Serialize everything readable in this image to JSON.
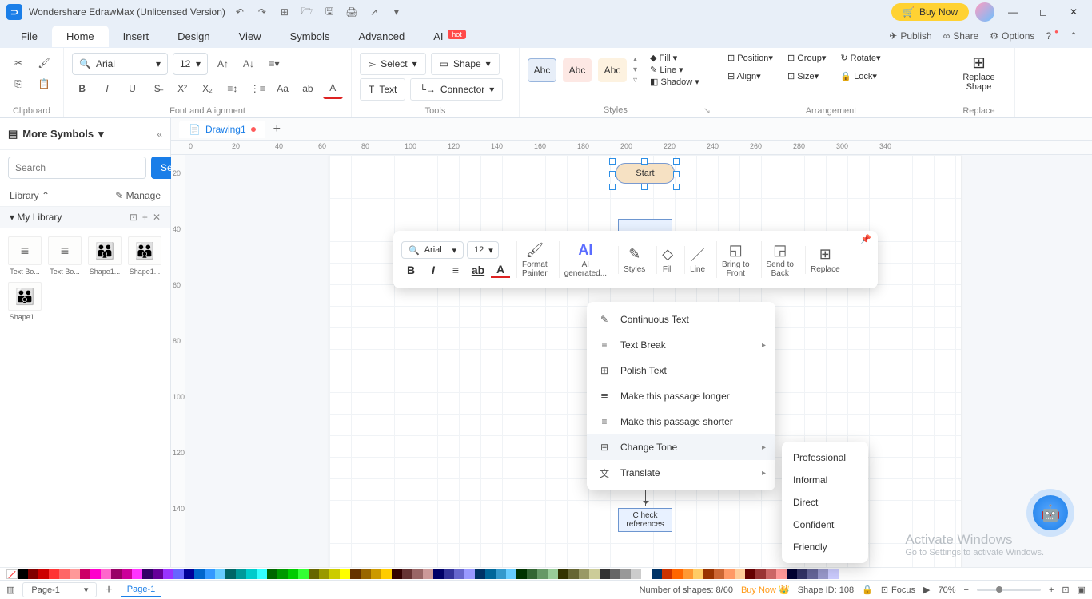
{
  "title": "Wondershare EdrawMax (Unlicensed Version)",
  "buy_now": "Buy Now",
  "menu": {
    "file": "File",
    "home": "Home",
    "insert": "Insert",
    "design": "Design",
    "view": "View",
    "symbols": "Symbols",
    "advanced": "Advanced",
    "ai": "AI",
    "ai_badge": "hot"
  },
  "menu_right": {
    "publish": "Publish",
    "share": "Share",
    "options": "Options"
  },
  "ribbon": {
    "clipboard": "Clipboard",
    "font_align": "Font and Alignment",
    "font_name": "Arial",
    "font_size": "12",
    "tools": "Tools",
    "select": "Select",
    "shape": "Shape",
    "text": "Text",
    "connector": "Connector",
    "styles": "Styles",
    "abc": "Abc",
    "fill": "Fill",
    "line": "Line",
    "shadow": "Shadow",
    "arrangement": "Arrangement",
    "position": "Position",
    "align": "Align",
    "group": "Group",
    "size": "Size",
    "rotate": "Rotate",
    "lock": "Lock",
    "replace": "Replace",
    "replace_shape": "Replace\nShape"
  },
  "left": {
    "more_symbols": "More Symbols",
    "search_placeholder": "Search",
    "search_btn": "Search",
    "library": "Library",
    "manage": "Manage",
    "my_library": "My Library",
    "shapes": [
      "Text Bo...",
      "Text Bo...",
      "Shape1...",
      "Shape1...",
      "Shape1..."
    ]
  },
  "tab": {
    "name": "Drawing1"
  },
  "ruler_h": [
    "0",
    "20",
    "40",
    "60",
    "80",
    "100",
    "120",
    "140",
    "160",
    "180",
    "200",
    "220",
    "240",
    "260",
    "280",
    "300",
    "340"
  ],
  "ruler_v": [
    "20",
    "40",
    "60",
    "80",
    "100",
    "120",
    "140"
  ],
  "flow": {
    "start": "Start",
    "check_ref": "C heck\nreferences"
  },
  "float_tb": {
    "font": "Arial",
    "size": "12",
    "format_painter": "Format\nPainter",
    "ai_generated": "AI\ngenerated...",
    "styles": "Styles",
    "fill": "Fill",
    "line": "Line",
    "bring_front": "Bring to\nFront",
    "send_back": "Send to\nBack",
    "replace": "Replace"
  },
  "ctx": {
    "continuous": "Continuous Text",
    "text_break": "Text Break",
    "polish": "Polish Text",
    "longer": "Make this passage longer",
    "shorter": "Make this passage shorter",
    "change_tone": "Change Tone",
    "translate": "Translate"
  },
  "tone": {
    "professional": "Professional",
    "informal": "Informal",
    "direct": "Direct",
    "confident": "Confident",
    "friendly": "Friendly"
  },
  "status": {
    "page_sel": "Page-1",
    "page_tab": "Page-1",
    "shapes_count": "Number of shapes: 8/60",
    "buy_now": "Buy Now",
    "shape_id": "Shape ID: 108",
    "focus": "Focus",
    "zoom": "70%"
  },
  "watermark": {
    "line1": "Activate Windows",
    "line2": "Go to Settings to activate Windows."
  }
}
